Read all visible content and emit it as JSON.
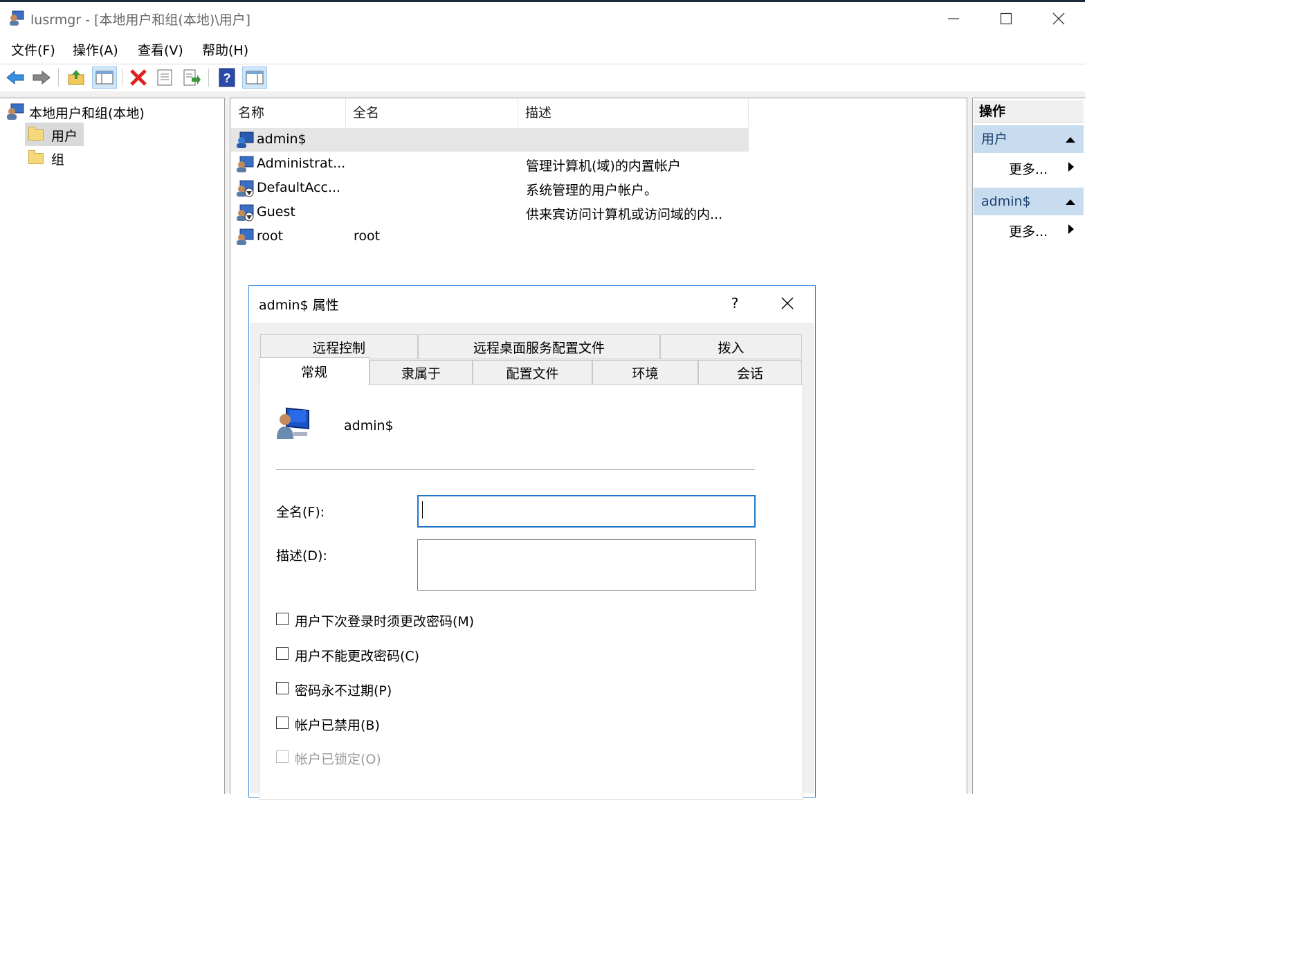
{
  "window": {
    "title": "lusrmgr - [本地用户和组(本地)\\用户]",
    "minimize_glyph": "—",
    "maximize_glyph": "☐",
    "close_glyph": "✕"
  },
  "menu": [
    "文件(F)",
    "操作(A)",
    "查看(V)",
    "帮助(H)"
  ],
  "toolbar": [
    "back-icon",
    "forward-icon",
    "up-folder-icon",
    "show-hide-tree-icon",
    "delete-icon",
    "properties-icon",
    "export-list-icon",
    "help-icon",
    "show-hide-action-pane-icon"
  ],
  "tree": {
    "root": "本地用户和组(本地)",
    "items": [
      "用户",
      "组"
    ],
    "selected": "用户"
  },
  "list": {
    "columns": [
      "名称",
      "全名",
      "描述"
    ],
    "rows": [
      {
        "name": "admin$",
        "fullname": "",
        "desc": ""
      },
      {
        "name": "Administrat...",
        "fullname": "",
        "desc": "管理计算机(域)的内置帐户"
      },
      {
        "name": "DefaultAcc...",
        "fullname": "",
        "desc": "系统管理的用户帐户。"
      },
      {
        "name": "Guest",
        "fullname": "",
        "desc": "供来宾访问计算机或访问域的内..."
      },
      {
        "name": "root",
        "fullname": "root",
        "desc": ""
      }
    ]
  },
  "actions": {
    "title": "操作",
    "sections": [
      {
        "label": "用户",
        "more": "更多..."
      },
      {
        "label": "admin$",
        "more": "更多..."
      }
    ]
  },
  "dialog": {
    "title": "admin$ 属性",
    "help_glyph": "?",
    "close_glyph": "✕",
    "tabs_row1": [
      "远程控制",
      "远程桌面服务配置文件",
      "拨入"
    ],
    "tabs_row2": [
      "常规",
      "隶属于",
      "配置文件",
      "环境",
      "会话"
    ],
    "active_tab": "常规",
    "username": "admin$",
    "fullname_label": "全名(F):",
    "fullname_value": "",
    "desc_label": "描述(D):",
    "desc_value": "",
    "checkboxes": [
      {
        "label": "用户下次登录时须更改密码(M)",
        "checked": false,
        "disabled": false
      },
      {
        "label": "用户不能更改密码(C)",
        "checked": false,
        "disabled": false
      },
      {
        "label": "密码永不过期(P)",
        "checked": false,
        "disabled": false
      },
      {
        "label": "帐户已禁用(B)",
        "checked": false,
        "disabled": false
      },
      {
        "label": "帐户已锁定(O)",
        "checked": false,
        "disabled": true
      }
    ]
  }
}
